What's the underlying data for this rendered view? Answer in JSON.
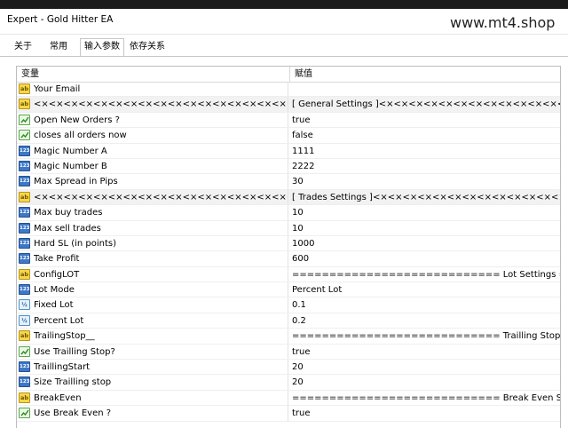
{
  "window": {
    "title": "Expert - Gold Hitter EA",
    "watermark": "www.mt4.shop"
  },
  "tabs": [
    {
      "label": "关于",
      "active": false
    },
    {
      "label": "常用",
      "active": false
    },
    {
      "label": "输入参数",
      "active": true
    },
    {
      "label": "依存关系",
      "active": false
    }
  ],
  "table": {
    "headers": {
      "variable": "变量",
      "value": "赋值"
    },
    "rows": [
      {
        "icon": "ab",
        "name": "Your Email",
        "value": ""
      },
      {
        "icon": "ab",
        "name": "<×<×<×<×<×<×<×<×<×<×<×<×<×<×<×<×<×<×<×<×<×<…",
        "value": "[ General Settings ]<×<×<×<×<×<×<×<×<×<×<×<×<×<×<×<×<×<×<×<×<×<",
        "sep": true
      },
      {
        "icon": "bool",
        "name": "Open New Orders ?",
        "value": "true"
      },
      {
        "icon": "bool",
        "name": "closes all orders now",
        "value": "false"
      },
      {
        "icon": "n123",
        "name": "Magic Number  A",
        "value": "1111"
      },
      {
        "icon": "n123",
        "name": "Magic Number  B",
        "value": "2222"
      },
      {
        "icon": "n123",
        "name": "Max Spread in Pips",
        "value": "30"
      },
      {
        "icon": "ab",
        "name": "<×<×<×<×<×<×<×<×<×<×<×<×<×<×<×<×<×<×<×<×<×<…",
        "value": "[ Trades Settings ]<×<×<×<×<×<×<×<×<×<×<×<×<×<×<×<×<×<×<×<×<…",
        "sep": true
      },
      {
        "icon": "n123",
        "name": "Max buy trades",
        "value": "10"
      },
      {
        "icon": "n123",
        "name": "Max sell trades",
        "value": "10"
      },
      {
        "icon": "n123",
        "name": "Hard SL (in points)",
        "value": "1000"
      },
      {
        "icon": "n123",
        "name": "Take Profit",
        "value": "600"
      },
      {
        "icon": "ab",
        "name": "ConfigLOT",
        "value": "============================ Lot Settings =…"
      },
      {
        "icon": "n123",
        "name": "Lot Mode",
        "value": "Percent Lot"
      },
      {
        "icon": "frac",
        "name": "Fixed Lot",
        "value": "0.1"
      },
      {
        "icon": "frac",
        "name": "Percent Lot",
        "value": "0.2"
      },
      {
        "icon": "ab",
        "name": "TrailingStop__",
        "value": "============================ Trailling Stop S…"
      },
      {
        "icon": "bool",
        "name": "Use Trailling Stop?",
        "value": "true"
      },
      {
        "icon": "n123",
        "name": "TraillingStart",
        "value": "20"
      },
      {
        "icon": "n123",
        "name": "Size Trailling stop",
        "value": "20"
      },
      {
        "icon": "ab",
        "name": "BreakEven",
        "value": "============================ Break Even Set…"
      },
      {
        "icon": "bool",
        "name": "Use Break Even ?",
        "value": "true"
      }
    ]
  },
  "icon_names": {
    "ab": "string-type-icon",
    "bool": "bool-type-icon",
    "n123": "integer-type-icon",
    "frac": "double-type-icon"
  },
  "icon_text": {
    "ab": "ab",
    "n123": "123",
    "frac": "½"
  }
}
